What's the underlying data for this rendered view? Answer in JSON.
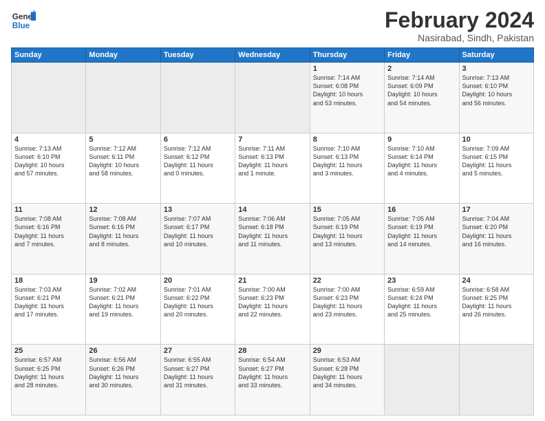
{
  "logo": {
    "line1": "General",
    "line2": "Blue"
  },
  "title": "February 2024",
  "subtitle": "Nasirabad, Sindh, Pakistan",
  "weekdays": [
    "Sunday",
    "Monday",
    "Tuesday",
    "Wednesday",
    "Thursday",
    "Friday",
    "Saturday"
  ],
  "weeks": [
    [
      {
        "day": "",
        "info": ""
      },
      {
        "day": "",
        "info": ""
      },
      {
        "day": "",
        "info": ""
      },
      {
        "day": "",
        "info": ""
      },
      {
        "day": "1",
        "info": "Sunrise: 7:14 AM\nSunset: 6:08 PM\nDaylight: 10 hours\nand 53 minutes."
      },
      {
        "day": "2",
        "info": "Sunrise: 7:14 AM\nSunset: 6:09 PM\nDaylight: 10 hours\nand 54 minutes."
      },
      {
        "day": "3",
        "info": "Sunrise: 7:13 AM\nSunset: 6:10 PM\nDaylight: 10 hours\nand 56 minutes."
      }
    ],
    [
      {
        "day": "4",
        "info": "Sunrise: 7:13 AM\nSunset: 6:10 PM\nDaylight: 10 hours\nand 57 minutes."
      },
      {
        "day": "5",
        "info": "Sunrise: 7:12 AM\nSunset: 6:11 PM\nDaylight: 10 hours\nand 58 minutes."
      },
      {
        "day": "6",
        "info": "Sunrise: 7:12 AM\nSunset: 6:12 PM\nDaylight: 11 hours\nand 0 minutes."
      },
      {
        "day": "7",
        "info": "Sunrise: 7:11 AM\nSunset: 6:13 PM\nDaylight: 11 hours\nand 1 minute."
      },
      {
        "day": "8",
        "info": "Sunrise: 7:10 AM\nSunset: 6:13 PM\nDaylight: 11 hours\nand 3 minutes."
      },
      {
        "day": "9",
        "info": "Sunrise: 7:10 AM\nSunset: 6:14 PM\nDaylight: 11 hours\nand 4 minutes."
      },
      {
        "day": "10",
        "info": "Sunrise: 7:09 AM\nSunset: 6:15 PM\nDaylight: 11 hours\nand 5 minutes."
      }
    ],
    [
      {
        "day": "11",
        "info": "Sunrise: 7:08 AM\nSunset: 6:16 PM\nDaylight: 11 hours\nand 7 minutes."
      },
      {
        "day": "12",
        "info": "Sunrise: 7:08 AM\nSunset: 6:16 PM\nDaylight: 11 hours\nand 8 minutes."
      },
      {
        "day": "13",
        "info": "Sunrise: 7:07 AM\nSunset: 6:17 PM\nDaylight: 11 hours\nand 10 minutes."
      },
      {
        "day": "14",
        "info": "Sunrise: 7:06 AM\nSunset: 6:18 PM\nDaylight: 11 hours\nand 11 minutes."
      },
      {
        "day": "15",
        "info": "Sunrise: 7:05 AM\nSunset: 6:19 PM\nDaylight: 11 hours\nand 13 minutes."
      },
      {
        "day": "16",
        "info": "Sunrise: 7:05 AM\nSunset: 6:19 PM\nDaylight: 11 hours\nand 14 minutes."
      },
      {
        "day": "17",
        "info": "Sunrise: 7:04 AM\nSunset: 6:20 PM\nDaylight: 11 hours\nand 16 minutes."
      }
    ],
    [
      {
        "day": "18",
        "info": "Sunrise: 7:03 AM\nSunset: 6:21 PM\nDaylight: 11 hours\nand 17 minutes."
      },
      {
        "day": "19",
        "info": "Sunrise: 7:02 AM\nSunset: 6:21 PM\nDaylight: 11 hours\nand 19 minutes."
      },
      {
        "day": "20",
        "info": "Sunrise: 7:01 AM\nSunset: 6:22 PM\nDaylight: 11 hours\nand 20 minutes."
      },
      {
        "day": "21",
        "info": "Sunrise: 7:00 AM\nSunset: 6:23 PM\nDaylight: 11 hours\nand 22 minutes."
      },
      {
        "day": "22",
        "info": "Sunrise: 7:00 AM\nSunset: 6:23 PM\nDaylight: 11 hours\nand 23 minutes."
      },
      {
        "day": "23",
        "info": "Sunrise: 6:59 AM\nSunset: 6:24 PM\nDaylight: 11 hours\nand 25 minutes."
      },
      {
        "day": "24",
        "info": "Sunrise: 6:58 AM\nSunset: 6:25 PM\nDaylight: 11 hours\nand 26 minutes."
      }
    ],
    [
      {
        "day": "25",
        "info": "Sunrise: 6:57 AM\nSunset: 6:25 PM\nDaylight: 11 hours\nand 28 minutes."
      },
      {
        "day": "26",
        "info": "Sunrise: 6:56 AM\nSunset: 6:26 PM\nDaylight: 11 hours\nand 30 minutes."
      },
      {
        "day": "27",
        "info": "Sunrise: 6:55 AM\nSunset: 6:27 PM\nDaylight: 11 hours\nand 31 minutes."
      },
      {
        "day": "28",
        "info": "Sunrise: 6:54 AM\nSunset: 6:27 PM\nDaylight: 11 hours\nand 33 minutes."
      },
      {
        "day": "29",
        "info": "Sunrise: 6:53 AM\nSunset: 6:28 PM\nDaylight: 11 hours\nand 34 minutes."
      },
      {
        "day": "",
        "info": ""
      },
      {
        "day": "",
        "info": ""
      }
    ]
  ]
}
